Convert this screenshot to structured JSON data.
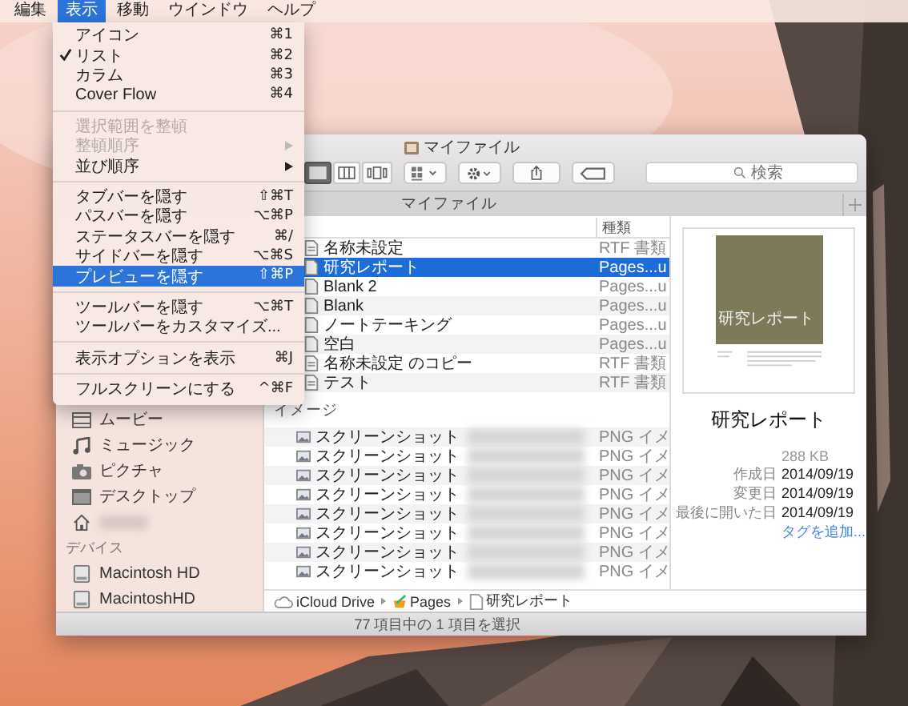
{
  "menubar": [
    {
      "label": "編集",
      "selected": false
    },
    {
      "label": "表示",
      "selected": true
    },
    {
      "label": "移動",
      "selected": false
    },
    {
      "label": "ウインドウ",
      "selected": false
    },
    {
      "label": "ヘルプ",
      "selected": false
    }
  ],
  "menu": [
    {
      "kind": "item",
      "label": "アイコン",
      "shortcut": "⌘1",
      "checked": false,
      "disabled": false,
      "selected": false,
      "submenu": false
    },
    {
      "kind": "item",
      "label": "リスト",
      "shortcut": "⌘2",
      "checked": true,
      "disabled": false,
      "selected": false,
      "submenu": false
    },
    {
      "kind": "item",
      "label": "カラム",
      "shortcut": "⌘3",
      "checked": false,
      "disabled": false,
      "selected": false,
      "submenu": false
    },
    {
      "kind": "item",
      "label": "Cover Flow",
      "shortcut": "⌘4",
      "checked": false,
      "disabled": false,
      "selected": false,
      "submenu": false
    },
    {
      "kind": "separator"
    },
    {
      "kind": "item",
      "label": "選択範囲を整頓",
      "checked": false,
      "disabled": true,
      "selected": false,
      "submenu": false
    },
    {
      "kind": "item",
      "label": "整頓順序",
      "checked": false,
      "disabled": true,
      "selected": false,
      "submenu": true
    },
    {
      "kind": "item",
      "label": "並び順序",
      "checked": false,
      "disabled": false,
      "selected": false,
      "submenu": true
    },
    {
      "kind": "separator"
    },
    {
      "kind": "item",
      "label": "タブバーを隠す",
      "shortcut": "⇧⌘T",
      "checked": false,
      "disabled": false,
      "selected": false,
      "submenu": false
    },
    {
      "kind": "item",
      "label": "パスバーを隠す",
      "shortcut": "⌥⌘P",
      "checked": false,
      "disabled": false,
      "selected": false,
      "submenu": false
    },
    {
      "kind": "item",
      "label": "ステータスバーを隠す",
      "shortcut": "⌘/",
      "checked": false,
      "disabled": false,
      "selected": false,
      "submenu": false
    },
    {
      "kind": "item",
      "label": "サイドバーを隠す",
      "shortcut": "⌥⌘S",
      "checked": false,
      "disabled": false,
      "selected": false,
      "submenu": false
    },
    {
      "kind": "item",
      "label": "プレビューを隠す",
      "shortcut": "⇧⌘P",
      "checked": false,
      "disabled": false,
      "selected": true,
      "submenu": false
    },
    {
      "kind": "separator"
    },
    {
      "kind": "item",
      "label": "ツールバーを隠す",
      "shortcut": "⌥⌘T",
      "checked": false,
      "disabled": false,
      "selected": false,
      "submenu": false
    },
    {
      "kind": "item",
      "label": "ツールバーをカスタマイズ...",
      "checked": false,
      "disabled": false,
      "selected": false,
      "submenu": false
    },
    {
      "kind": "separator"
    },
    {
      "kind": "item",
      "label": "表示オプションを表示",
      "shortcut": "⌘J",
      "checked": false,
      "disabled": false,
      "selected": false,
      "submenu": false
    },
    {
      "kind": "separator"
    },
    {
      "kind": "item",
      "label": "フルスクリーンにする",
      "shortcut": "^⌘F",
      "checked": false,
      "disabled": false,
      "selected": false,
      "submenu": false
    }
  ],
  "window": {
    "title": "マイファイル",
    "tab": "マイファイル",
    "views": [
      {
        "kind": "list",
        "selected": true
      },
      {
        "kind": "columns",
        "selected": false
      },
      {
        "kind": "coverflow",
        "selected": false
      }
    ],
    "search": {
      "placeholder": "検索"
    }
  },
  "sidebar": {
    "favorites": [
      {
        "kind": "movies",
        "label": "ムービー"
      },
      {
        "kind": "music",
        "label": "ミュージック"
      },
      {
        "kind": "pictures",
        "label": "ピクチャ"
      },
      {
        "kind": "desktop",
        "label": "デスクトップ"
      },
      {
        "kind": "home"
      }
    ],
    "devices": {
      "title": "デバイス",
      "items": [
        {
          "kind": "disk",
          "label": "Macintosh HD"
        },
        {
          "kind": "disk",
          "label": "MacintoshHD"
        }
      ]
    }
  },
  "file_list": {
    "columns": [
      "種類"
    ],
    "rows": [
      {
        "kind": "rtf",
        "name": "名称未設定",
        "type": "RTF 書類",
        "selected": false
      },
      {
        "kind": "pages",
        "name": "研究レポート",
        "type": "Pages...u",
        "selected": true
      },
      {
        "kind": "pages",
        "name": "Blank 2",
        "type": "Pages...u",
        "selected": false
      },
      {
        "kind": "pages",
        "name": "Blank",
        "type": "Pages...u",
        "selected": false
      },
      {
        "kind": "pages",
        "name": "ノートテーキング",
        "type": "Pages...u",
        "selected": false
      },
      {
        "kind": "pages",
        "name": "空白",
        "type": "Pages...u",
        "selected": false
      },
      {
        "kind": "rtf",
        "name": "名称未設定 のコピー",
        "type": "RTF 書類",
        "selected": false
      },
      {
        "kind": "rtf",
        "name": "テスト",
        "type": "RTF 書類",
        "selected": false
      }
    ],
    "group": {
      "title": "イメージ",
      "rows": [
        {
          "kind": "png",
          "name": "スクリーンショット",
          "type": "PNG イメ",
          "selected": false
        },
        {
          "kind": "png",
          "name": "スクリーンショット",
          "type": "PNG イメ",
          "selected": false
        },
        {
          "kind": "png",
          "name": "スクリーンショット",
          "type": "PNG イメ",
          "selected": false
        },
        {
          "kind": "png",
          "name": "スクリーンショット",
          "type": "PNG イメ",
          "selected": false
        },
        {
          "kind": "png",
          "name": "スクリーンショット",
          "type": "PNG イメ",
          "selected": false
        },
        {
          "kind": "png",
          "name": "スクリーンショット",
          "type": "PNG イメ",
          "selected": false
        },
        {
          "kind": "png",
          "name": "スクリーンショット",
          "type": "PNG イメ",
          "selected": false
        },
        {
          "kind": "png",
          "name": "スクリーンショット",
          "type": "PNG イメ",
          "selected": false
        }
      ]
    }
  },
  "preview": {
    "thumbnail_title": "研究レポート",
    "name": "研究レポート",
    "size": "288 KB",
    "info": [
      {
        "label": "作成日",
        "value": "2014/09/19"
      },
      {
        "label": "変更日",
        "value": "2014/09/19"
      },
      {
        "label": "最後に開いた日",
        "value": "2014/09/19"
      }
    ],
    "tags_link": "タグを追加..."
  },
  "path_bar": [
    {
      "kind": "cloud",
      "label": "iCloud Drive"
    },
    {
      "kind": "app",
      "label": "Pages"
    },
    {
      "kind": "document",
      "label": "研究レポート"
    }
  ],
  "status_bar": "77 項目中の 1 項目を選択"
}
